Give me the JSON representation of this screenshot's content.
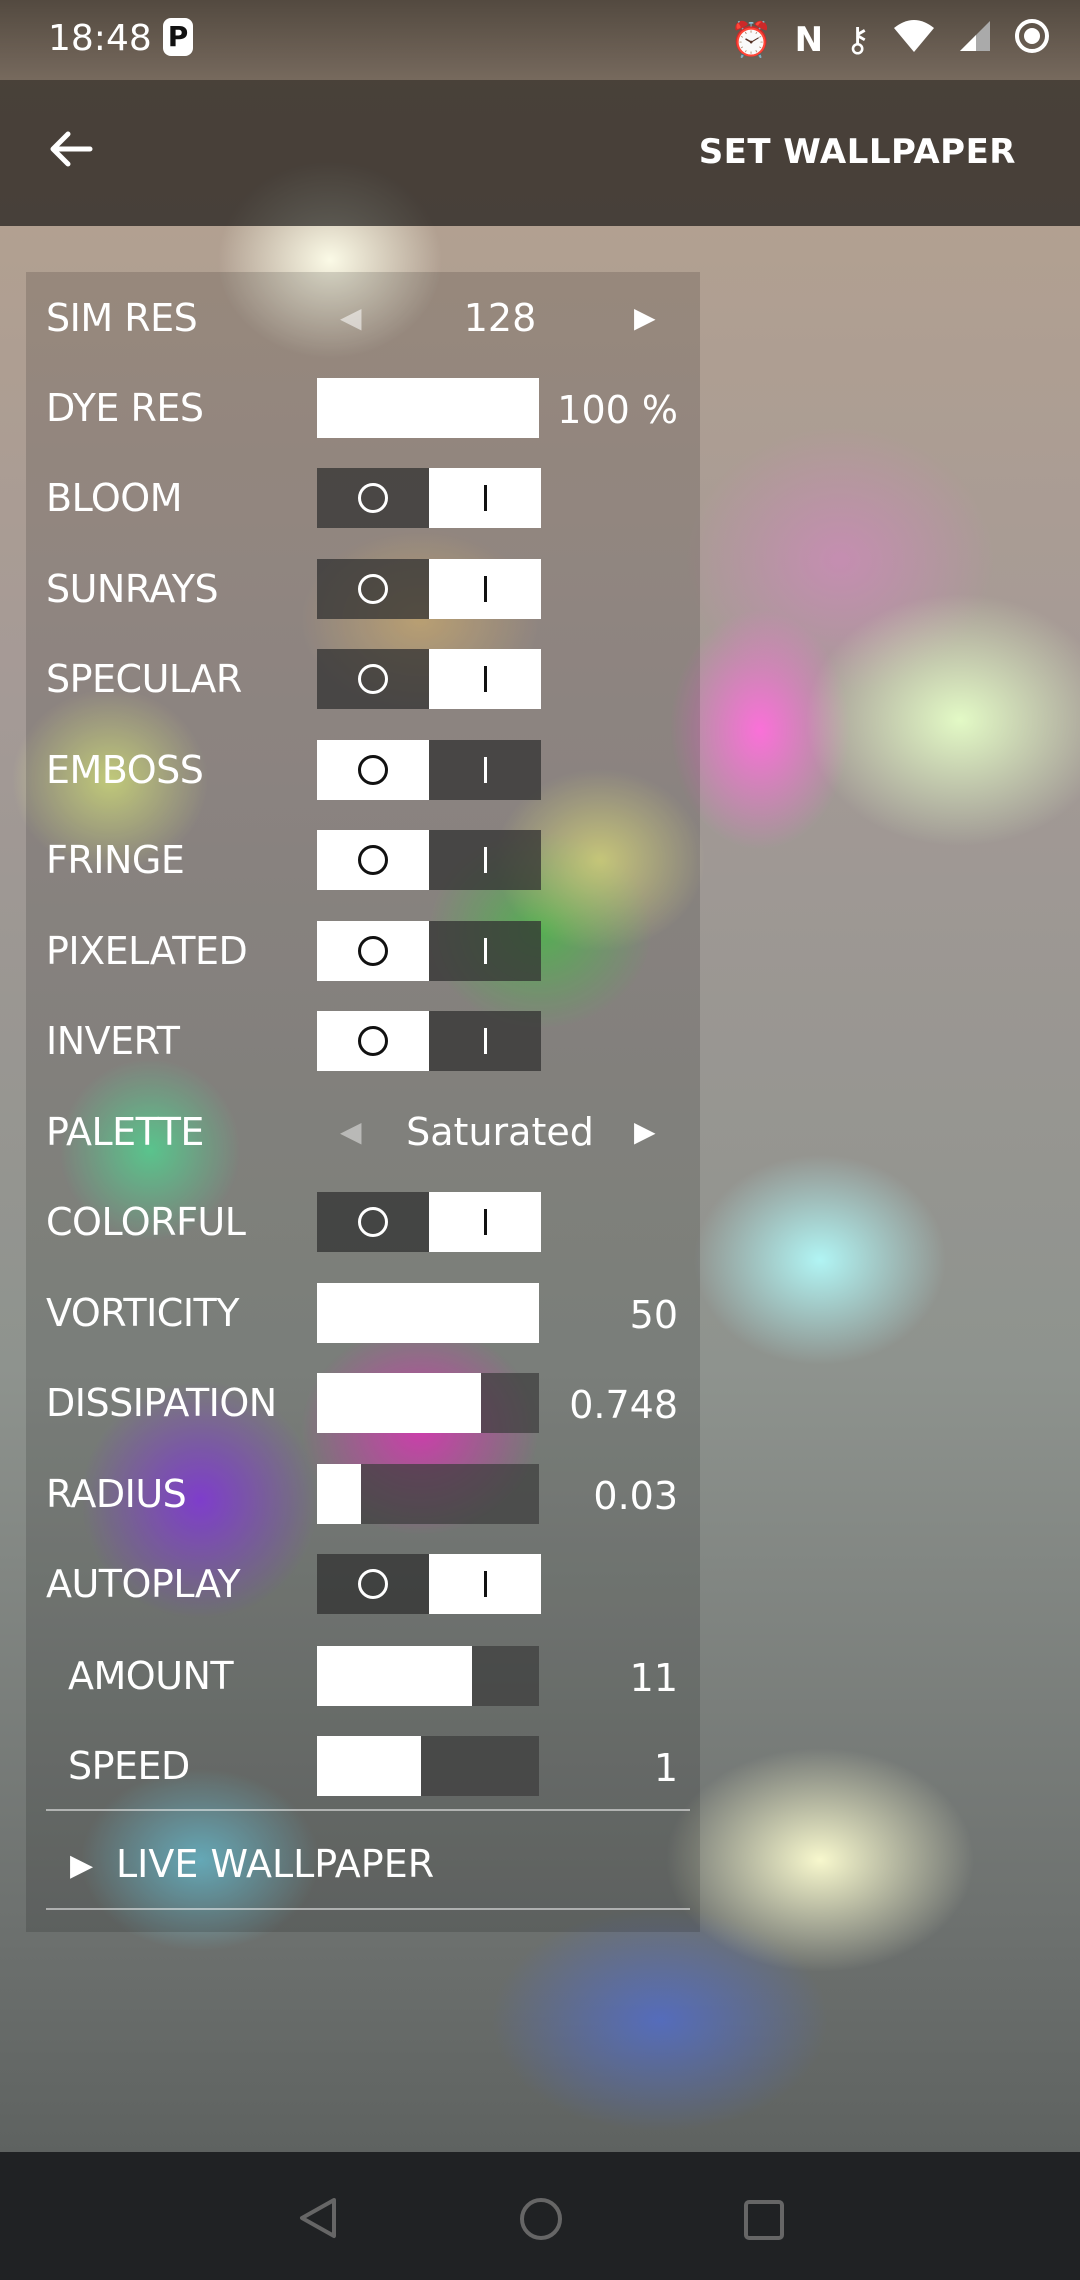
{
  "status_bar": {
    "time": "18:48",
    "icons": [
      "p-icon",
      "alarm-icon",
      "nfc-icon",
      "vpn-key-icon",
      "wifi-icon",
      "signal-icon",
      "record-icon"
    ]
  },
  "app_bar": {
    "action_label": "SET WALLPAPER"
  },
  "settings": {
    "sim_res": {
      "label": "SIM RES",
      "value": "128"
    },
    "dye_res": {
      "label": "DYE RES",
      "value": "100 %",
      "level": 1.0
    },
    "bloom": {
      "label": "BLOOM",
      "on": true
    },
    "sunrays": {
      "label": "SUNRAYS",
      "on": true
    },
    "specular": {
      "label": "SPECULAR",
      "on": true
    },
    "emboss": {
      "label": "EMBOSS",
      "on": false
    },
    "fringe": {
      "label": "FRINGE",
      "on": false
    },
    "pixelated": {
      "label": "PIXELATED",
      "on": false
    },
    "invert": {
      "label": "INVERT",
      "on": false
    },
    "palette": {
      "label": "PALETTE",
      "value": "Saturated"
    },
    "colorful": {
      "label": "COLORFUL",
      "on": true
    },
    "vorticity": {
      "label": "VORTICITY",
      "value": "50",
      "level": 1.0
    },
    "dissipation": {
      "label": "DISSIPATION",
      "value": "0.748",
      "level": 0.74
    },
    "radius": {
      "label": "RADIUS",
      "value": "0.03",
      "level": 0.2
    },
    "autoplay": {
      "label": "AUTOPLAY",
      "on": true
    },
    "amount": {
      "label": "AMOUNT",
      "value": "11",
      "level": 0.7
    },
    "speed": {
      "label": "SPEED",
      "value": "1",
      "level": 0.47
    }
  },
  "folder": {
    "label": "LIVE WALLPAPER"
  },
  "nav_bar": {
    "icons": [
      "back-triangle-icon",
      "home-circle-icon",
      "recents-square-icon"
    ]
  }
}
